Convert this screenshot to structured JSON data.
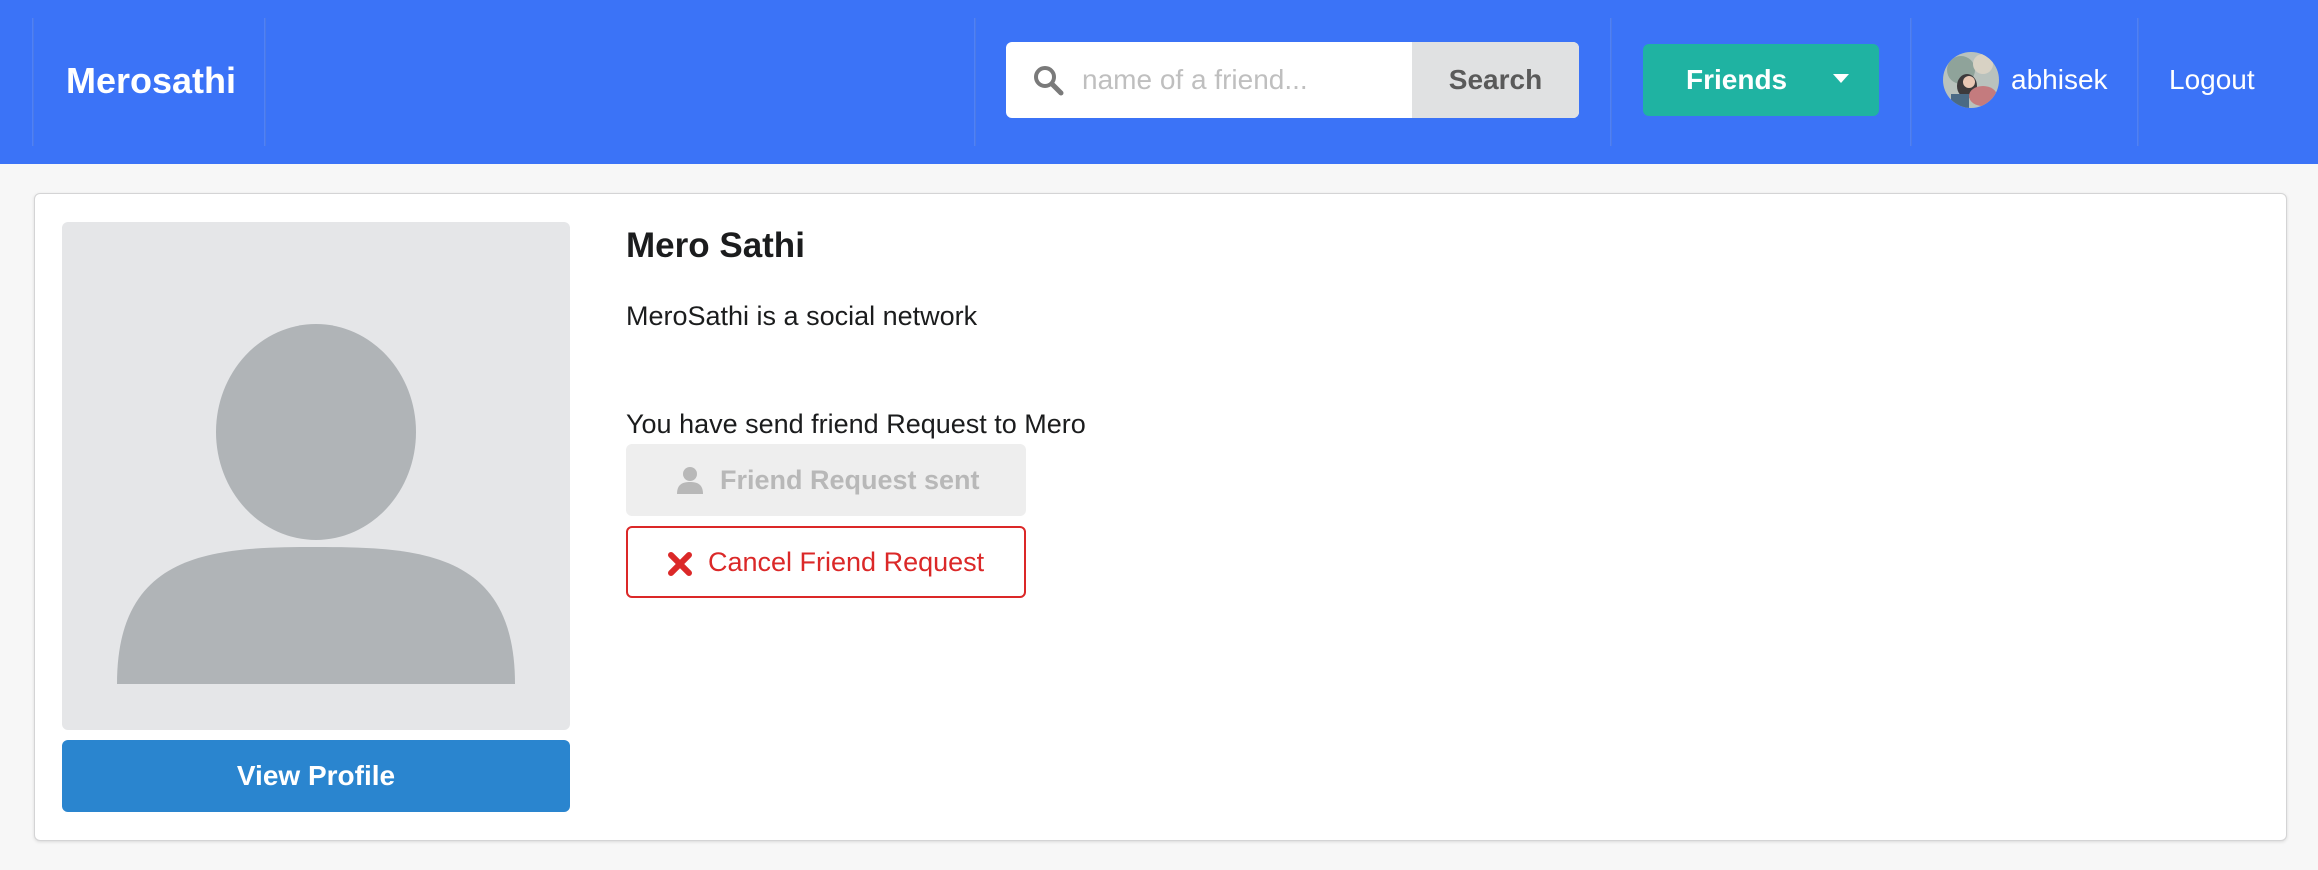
{
  "navbar": {
    "brand": "Merosathi",
    "search_placeholder": "name of a friend...",
    "search_button": "Search",
    "friends_button": "Friends",
    "username": "abhisek",
    "logout": "Logout",
    "bg_color": "#3b73f7"
  },
  "profile": {
    "name": "Mero Sathi",
    "description": "MeroSathi is a social network",
    "status_text": "You have send friend Request to Mero",
    "view_profile_button": "View Profile",
    "request_sent_button": "Friend Request sent",
    "cancel_button": "Cancel Friend Request"
  },
  "icons": {
    "search": "search-icon",
    "user": "user-icon",
    "close": "close-icon",
    "dropdown": "caret-down-icon"
  },
  "colors": {
    "accent": "#3b73f7",
    "friends": "#1fb3a2",
    "view_profile": "#2a85cf",
    "danger": "#db2828"
  }
}
